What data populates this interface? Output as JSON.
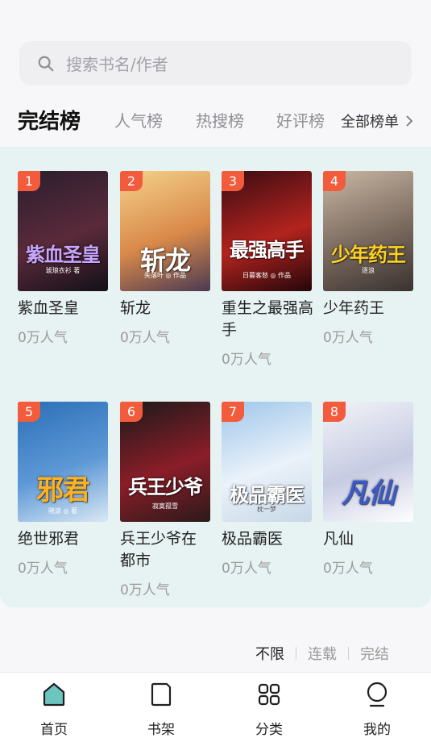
{
  "search": {
    "placeholder": "搜索书名/作者"
  },
  "tabs": [
    {
      "label": "完结榜",
      "active": true
    },
    {
      "label": "人气榜",
      "active": false
    },
    {
      "label": "热搜榜",
      "active": false
    },
    {
      "label": "好评榜",
      "active": false
    }
  ],
  "all_lists_label": "全部榜单",
  "books": [
    {
      "rank": "1",
      "title": "紫血圣皇",
      "popularity": "0万人气",
      "cover_text": "紫血圣皇",
      "cover_author": "琥琅衣衫 著",
      "cover_colors": [
        "#2a1e2e",
        "#5a2a3a",
        "#131018"
      ],
      "cover_text_color": "#c9a6ff"
    },
    {
      "rank": "2",
      "title": "斩龙",
      "popularity": "0万人气",
      "cover_text": "斩龙",
      "cover_author": "失落叶 ◎ 作品",
      "cover_colors": [
        "#f4d28a",
        "#d9894a",
        "#4a3a52"
      ],
      "cover_text_color": "#ffffff"
    },
    {
      "rank": "3",
      "title": "重生之最强高手",
      "popularity": "0万人气",
      "cover_text": "最强高手",
      "cover_author": "日暮客愁 ◎ 作品",
      "cover_colors": [
        "#3a0c12",
        "#b2231e",
        "#24060a"
      ],
      "cover_text_color": "#ffffff"
    },
    {
      "rank": "4",
      "title": "少年药王",
      "popularity": "0万人气",
      "cover_text": "少年药王",
      "cover_author": "逐浪",
      "cover_colors": [
        "#c9b7a4",
        "#7a6a5e",
        "#3a3230"
      ],
      "cover_text_color": "#ffd21f"
    },
    {
      "rank": "5",
      "title": "绝世邪君",
      "popularity": "0万人气",
      "cover_text": "邪君",
      "cover_author": "晓浪 ◎ 著",
      "cover_colors": [
        "#2b6fb7",
        "#5d98d6",
        "#d9e8f4"
      ],
      "cover_text_color": "#ffb21f"
    },
    {
      "rank": "6",
      "title": "兵王少爷在都市",
      "popularity": "0万人气",
      "cover_text": "兵王少爷",
      "cover_author": "寂寞孤雪",
      "cover_colors": [
        "#1a1a1a",
        "#8a1d28",
        "#2b1a1a"
      ],
      "cover_text_color": "#ffffff"
    },
    {
      "rank": "7",
      "title": "极品霸医",
      "popularity": "0万人气",
      "cover_text": "极品霸医",
      "cover_author": "枕一梦",
      "cover_colors": [
        "#9fc6ea",
        "#eaf2fa",
        "#c7d7e6"
      ],
      "cover_text_color": "#ffffff"
    },
    {
      "rank": "8",
      "title": "凡仙",
      "popularity": "0万人气",
      "cover_text": "凡仙",
      "cover_author": "",
      "cover_colors": [
        "#f2f4f8",
        "#c7cbe2",
        "#ffffff"
      ],
      "cover_text_color": "#3a5ad0"
    }
  ],
  "filter": [
    {
      "label": "不限",
      "selected": true
    },
    {
      "label": "连载",
      "selected": false
    },
    {
      "label": "完结",
      "selected": false
    }
  ],
  "nav": [
    {
      "label": "首页",
      "icon": "home-icon",
      "active": true
    },
    {
      "label": "书架",
      "icon": "bookshelf-icon",
      "active": false
    },
    {
      "label": "分类",
      "icon": "category-grid-icon",
      "active": false
    },
    {
      "label": "我的",
      "icon": "profile-icon",
      "active": false
    }
  ]
}
